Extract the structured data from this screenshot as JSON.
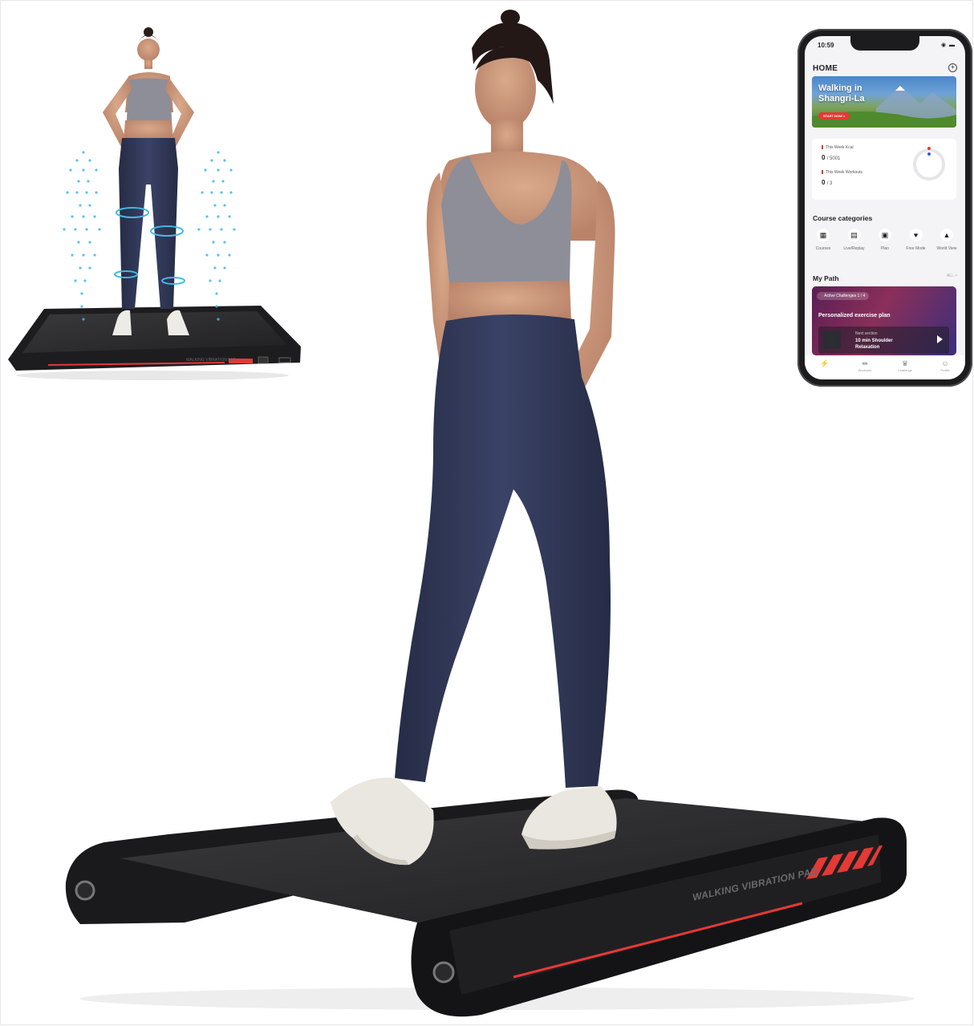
{
  "colors": {
    "accent_red": "#e53935",
    "deck_black": "#1d1d1f",
    "leggings_navy": "#2c3350",
    "top_gray": "#8d8e98",
    "sensor_cyan": "#42b8e6"
  },
  "treadmill": {
    "deck_label": "WALKING VIBRATION PAD",
    "mini_label": "WALKING VIBRATION PAD"
  },
  "phone": {
    "time": "10:59",
    "status_icons": "◉ ▬",
    "header_title": "HOME",
    "add_icon": "plus-circle-icon",
    "banner": {
      "title": "Walking in Shangri-La",
      "button": "START NOW >"
    },
    "stats": [
      {
        "label": "This Week Kcal",
        "value": "0",
        "target": "/ 5001"
      },
      {
        "label": "This Week Workouts",
        "value": "0",
        "target": "/ 3"
      }
    ],
    "course_categories_title": "Course categories",
    "categories": [
      {
        "label": "Courses",
        "icon": "grid-icon",
        "glyph": "▦"
      },
      {
        "label": "Live/Replay",
        "icon": "document-icon",
        "glyph": "▤"
      },
      {
        "label": "Plan",
        "icon": "calendar-icon",
        "glyph": "▣"
      },
      {
        "label": "Free Mode",
        "icon": "heartbeat-icon",
        "glyph": "♥"
      },
      {
        "label": "World View",
        "icon": "mountain-icon",
        "glyph": "▲"
      }
    ],
    "my_path_title": "My Path",
    "all_link": "ALL >",
    "path_card": {
      "chip": "Active Challenges 1 / 4",
      "title": "Personalized exercise plan",
      "next_label": "Next section",
      "next_title": "10 min Shoulder Relaxation"
    },
    "tabs": [
      {
        "label": "",
        "icon": "bolt-icon",
        "glyph": "⚡",
        "active": true
      },
      {
        "label": "Workouts",
        "icon": "dumbbell-icon",
        "glyph": "⇹",
        "active": false
      },
      {
        "label": "Challenge",
        "icon": "trophy-icon",
        "glyph": "♛",
        "active": false
      },
      {
        "label": "Profile",
        "icon": "profile-icon",
        "glyph": "☺",
        "active": false
      }
    ]
  }
}
